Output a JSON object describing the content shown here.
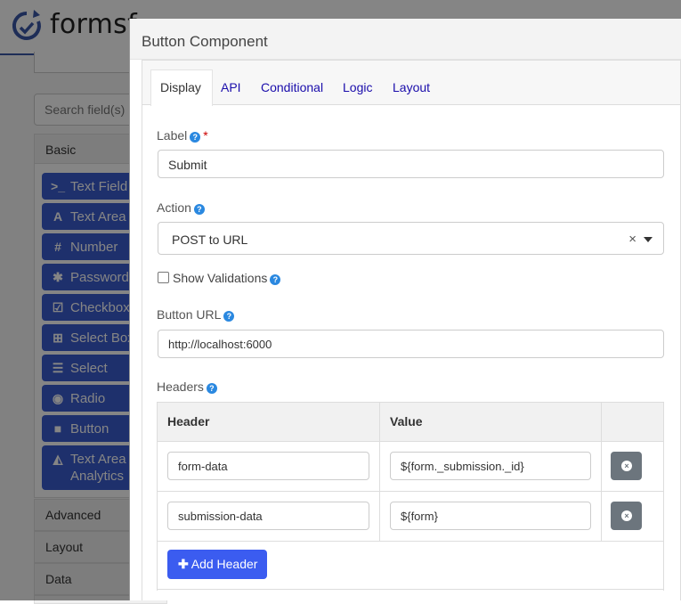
{
  "app": {
    "logo_text": "formsf",
    "sidebar": {
      "search_placeholder": "Search field(s)",
      "groups": {
        "basic": "Basic",
        "advanced": "Advanced",
        "layout": "Layout",
        "data": "Data"
      },
      "basic_items": [
        {
          "label": "Text Field",
          "icon": "terminal-icon"
        },
        {
          "label": "Text Area",
          "icon": "font-icon"
        },
        {
          "label": "Number",
          "icon": "hashtag-icon"
        },
        {
          "label": "Password",
          "icon": "asterisk-icon"
        },
        {
          "label": "Checkbox",
          "icon": "check-square-icon"
        },
        {
          "label": "Select Boxes",
          "icon": "plus-square-icon"
        },
        {
          "label": "Select",
          "icon": "list-icon"
        },
        {
          "label": "Radio",
          "icon": "dot-circle-icon"
        },
        {
          "label": "Button",
          "icon": "stop-icon"
        },
        {
          "label": "Text Area Analytics",
          "icon": "area-chart-icon"
        }
      ]
    }
  },
  "modal": {
    "title": "Button Component",
    "tabs": [
      {
        "label": "Display",
        "active": true
      },
      {
        "label": "API",
        "active": false
      },
      {
        "label": "Conditional",
        "active": false
      },
      {
        "label": "Logic",
        "active": false
      },
      {
        "label": "Layout",
        "active": false
      }
    ],
    "label_field": {
      "label": "Label",
      "required": "*",
      "value": "Submit"
    },
    "action_field": {
      "label": "Action",
      "value": "POST to URL",
      "clear": "×"
    },
    "show_validations": {
      "label": "Show Validations",
      "checked": false
    },
    "button_url": {
      "label": "Button URL",
      "value": "http://localhost:6000"
    },
    "headers": {
      "label": "Headers",
      "columns": [
        "Header",
        "Value"
      ],
      "rows": [
        {
          "header": "form-data",
          "value": "${form._submission._id}"
        },
        {
          "header": "submission-data",
          "value": "${form}"
        }
      ],
      "add_label": "Add Header"
    }
  },
  "colors": {
    "primary": "#3b5cf0",
    "sidebar_button": "#3b5ccf",
    "help_icon": "#2a88e0",
    "delete_button": "#6c757d",
    "required": "#cc0000"
  }
}
